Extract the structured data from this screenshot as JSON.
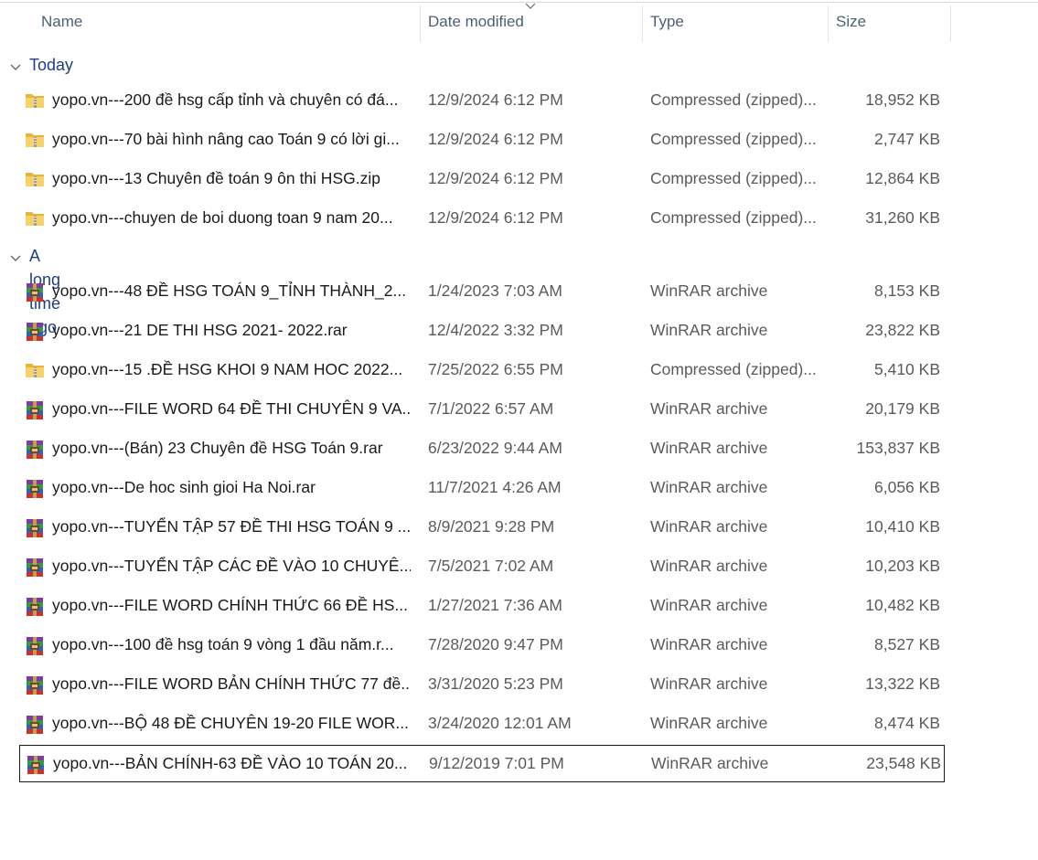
{
  "columns": {
    "name": "Name",
    "date": "Date modified",
    "type": "Type",
    "size": "Size"
  },
  "sort": {
    "column": "date",
    "indicator": "chevron-down-icon"
  },
  "colors": {
    "group_label": "#1f3c88",
    "header_text": "#4c5f78",
    "meta_text": "#5a5a5a"
  },
  "groups": [
    {
      "label": "Today",
      "items": [
        {
          "name": "yopo.vn---200 đề hsg cấp tỉnh và chuyên có đá...",
          "date": "12/9/2024 6:12 PM",
          "type": "Compressed (zipped)...",
          "size": "18,952 KB",
          "icon": "zip-folder-icon"
        },
        {
          "name": "yopo.vn---70 bài hình nâng cao Toán 9 có lời gi...",
          "date": "12/9/2024 6:12 PM",
          "type": "Compressed (zipped)...",
          "size": "2,747 KB",
          "icon": "zip-folder-icon"
        },
        {
          "name": "yopo.vn---13 Chuyên đề toán 9 ôn thi HSG.zip",
          "date": "12/9/2024 6:12 PM",
          "type": "Compressed (zipped)...",
          "size": "12,864 KB",
          "icon": "zip-folder-icon"
        },
        {
          "name": "yopo.vn---chuyen de boi duong toan 9 nam 20...",
          "date": "12/9/2024 6:12 PM",
          "type": "Compressed (zipped)...",
          "size": "31,260 KB",
          "icon": "zip-folder-icon"
        }
      ]
    },
    {
      "label": "A long time ago",
      "items": [
        {
          "name": "yopo.vn---48 ĐỀ HSG TOÁN 9_TỈNH THÀNH_2...",
          "date": "1/24/2023 7:03 AM",
          "type": "WinRAR archive",
          "size": "8,153 KB",
          "icon": "winrar-icon"
        },
        {
          "name": "yopo.vn---21 DE THI HSG 2021- 2022.rar",
          "date": "12/4/2022 3:32 PM",
          "type": "WinRAR archive",
          "size": "23,822 KB",
          "icon": "winrar-icon"
        },
        {
          "name": "yopo.vn---15 .ĐỀ HSG KHOI 9 NAM HOC 2022...",
          "date": "7/25/2022 6:55 PM",
          "type": "Compressed (zipped)...",
          "size": "5,410 KB",
          "icon": "zip-folder-icon"
        },
        {
          "name": "yopo.vn---FILE WORD 64 ĐỀ THI CHUYÊN 9 VA...",
          "date": "7/1/2022 6:57 AM",
          "type": "WinRAR archive",
          "size": "20,179 KB",
          "icon": "winrar-icon"
        },
        {
          "name": "yopo.vn---(Bán) 23 Chuyên đề HSG Toán 9.rar",
          "date": "6/23/2022 9:44 AM",
          "type": "WinRAR archive",
          "size": "153,837 KB",
          "icon": "winrar-icon"
        },
        {
          "name": "yopo.vn---De hoc sinh gioi Ha Noi.rar",
          "date": "11/7/2021 4:26 AM",
          "type": "WinRAR archive",
          "size": "6,056 KB",
          "icon": "winrar-icon"
        },
        {
          "name": "yopo.vn---TUYỂN TẬP 57 ĐỀ THI HSG TOÁN 9 ...",
          "date": "8/9/2021 9:28 PM",
          "type": "WinRAR archive",
          "size": "10,410 KB",
          "icon": "winrar-icon"
        },
        {
          "name": "yopo.vn---TUYỂN TẬP CÁC ĐỀ VÀO 10 CHUYÊ...",
          "date": "7/5/2021 7:02 AM",
          "type": "WinRAR archive",
          "size": "10,203 KB",
          "icon": "winrar-icon"
        },
        {
          "name": "yopo.vn---FILE WORD CHÍNH THỨC 66 ĐỀ HS...",
          "date": "1/27/2021 7:36 AM",
          "type": "WinRAR archive",
          "size": "10,482 KB",
          "icon": "winrar-icon"
        },
        {
          "name": "yopo.vn---100 đề hsg toán 9 vòng 1 đầu năm.r...",
          "date": "7/28/2020 9:47 PM",
          "type": "WinRAR archive",
          "size": "8,527 KB",
          "icon": "winrar-icon"
        },
        {
          "name": "yopo.vn---FILE WORD BẢN CHÍNH THỨC 77 đề...",
          "date": "3/31/2020 5:23 PM",
          "type": "WinRAR archive",
          "size": "13,322 KB",
          "icon": "winrar-icon"
        },
        {
          "name": "yopo.vn---BỘ 48 ĐỀ CHUYÊN 19-20 FILE WOR...",
          "date": "3/24/2020 12:01 AM",
          "type": "WinRAR archive",
          "size": "8,474 KB",
          "icon": "winrar-icon"
        },
        {
          "name": "yopo.vn---BẢN CHÍNH-63 ĐỀ VÀO 10 TOÁN 20...",
          "date": "9/12/2019 7:01 PM",
          "type": "WinRAR archive",
          "size": "23,548 KB",
          "icon": "winrar-icon",
          "selected": true
        }
      ]
    }
  ]
}
